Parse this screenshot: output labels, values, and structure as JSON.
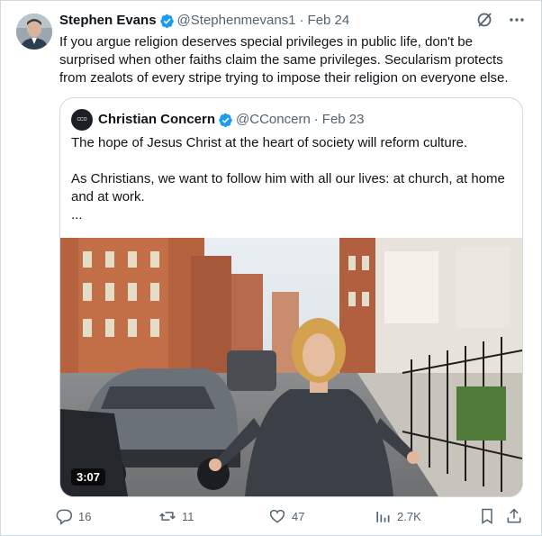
{
  "tweet": {
    "author_name": "Stephen Evans",
    "handle": "@Stephenmevans1",
    "separator": "·",
    "date": "Feb 24",
    "text": "If you argue religion deserves special privileges in public life, don't be surprised when other faiths claim the same privileges. Secularism protects from zealots of every stripe trying to impose their religion on everyone else."
  },
  "quoted": {
    "author_name": "Christian Concern",
    "avatar_text": "CCO",
    "handle": "@CConcern",
    "separator": "·",
    "date": "Feb 23",
    "line1": "The hope of Jesus Christ at the heart of society will reform culture.",
    "line2": "As Christians, we want to follow him with all our lives: at church, at home and at work.",
    "line3": "...",
    "video_duration": "3:07"
  },
  "metrics": {
    "replies": "16",
    "reposts": "11",
    "likes": "47",
    "views": "2.7K"
  },
  "colors": {
    "accent": "#1d9bf0",
    "text": "#0f1419",
    "secondary_text": "#536471",
    "border": "#cfd9de"
  },
  "icons": [
    "verified-badge-icon",
    "grok-icon",
    "more-icon",
    "reply-icon",
    "repost-icon",
    "like-icon",
    "views-icon",
    "bookmark-icon",
    "share-icon"
  ]
}
